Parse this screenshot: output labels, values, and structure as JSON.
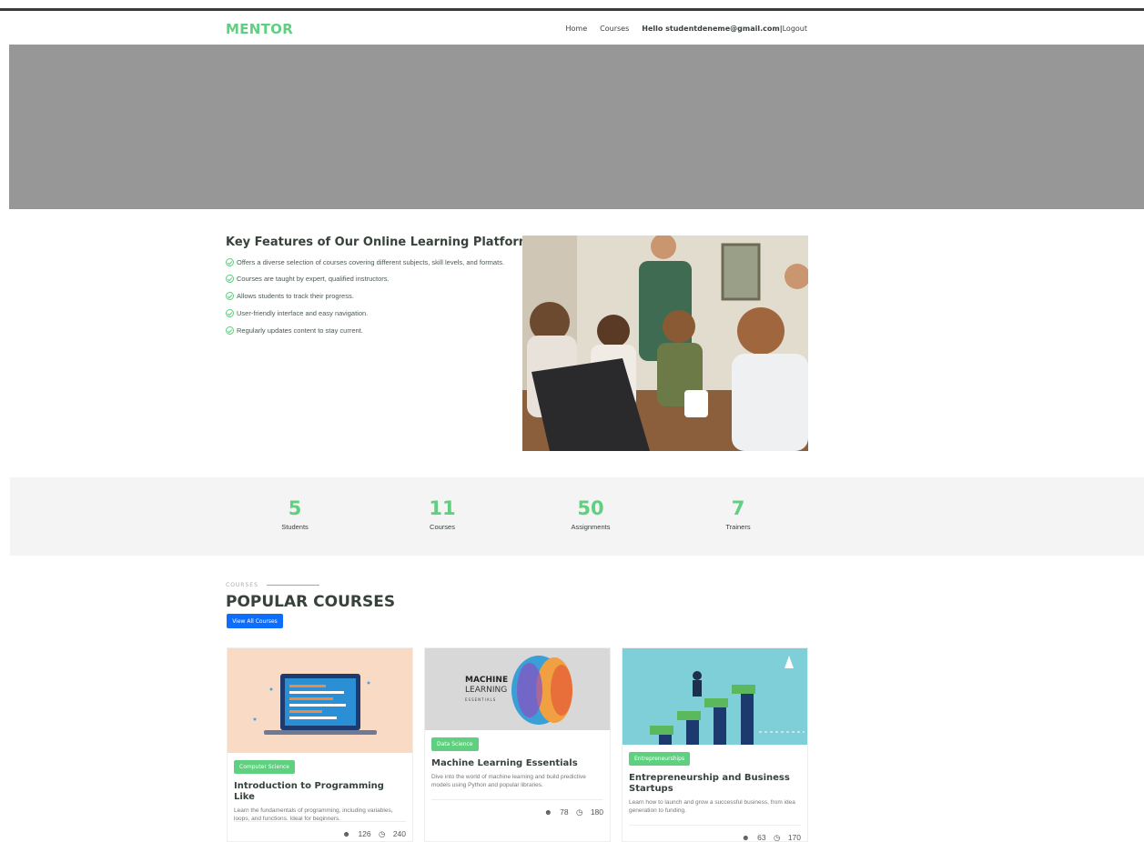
{
  "header": {
    "logo": "MENTOR",
    "nav": {
      "home": "Home",
      "courses": "Courses",
      "greeting": "Hello studentdeneme@gmail.com",
      "separator": "|",
      "logout": "Logout"
    }
  },
  "features": {
    "title": "Key Features of Our Online Learning Platform",
    "items": [
      "Offers a diverse selection of courses covering different subjects, skill levels, and formats.",
      "Courses are taught by expert, qualified instructors.",
      "Allows students to track their progress.",
      "User-friendly interface and easy navigation.",
      "Regularly updates content to stay current."
    ]
  },
  "counts": [
    {
      "value": "5",
      "label": "Students"
    },
    {
      "value": "11",
      "label": "Courses"
    },
    {
      "value": "50",
      "label": "Assignments"
    },
    {
      "value": "7",
      "label": "Trainers"
    }
  ],
  "popular": {
    "section_label": "COURSES",
    "title": "POPULAR COURSES",
    "view_all": "View All Courses",
    "courses": [
      {
        "category": "Computer Science",
        "title": "Introduction to Programming Like",
        "description": "Learn the fundamentals of programming, including variables, loops, and functions. Ideal for beginners.",
        "students": "126",
        "duration": "240"
      },
      {
        "category": "Data Science",
        "title": "Machine Learning Essentials",
        "description": "Dive into the world of machine learning and build predictive models using Python and popular libraries.",
        "students": "78",
        "duration": "180",
        "image_text": {
          "line1": "MACHINE",
          "line2": "LEARNING",
          "line3": "ESSENTIALS"
        }
      },
      {
        "category": "Entrepreneurships",
        "title": "Entrepreneurship and Business Startups",
        "description": "Learn how to launch and grow a successful business, from idea generation to funding.",
        "students": "63",
        "duration": "170"
      }
    ]
  },
  "colors": {
    "accent": "#5fcf80",
    "button": "#0d6efd",
    "hero": "#979797",
    "counts_bg": "#f4f4f4"
  }
}
